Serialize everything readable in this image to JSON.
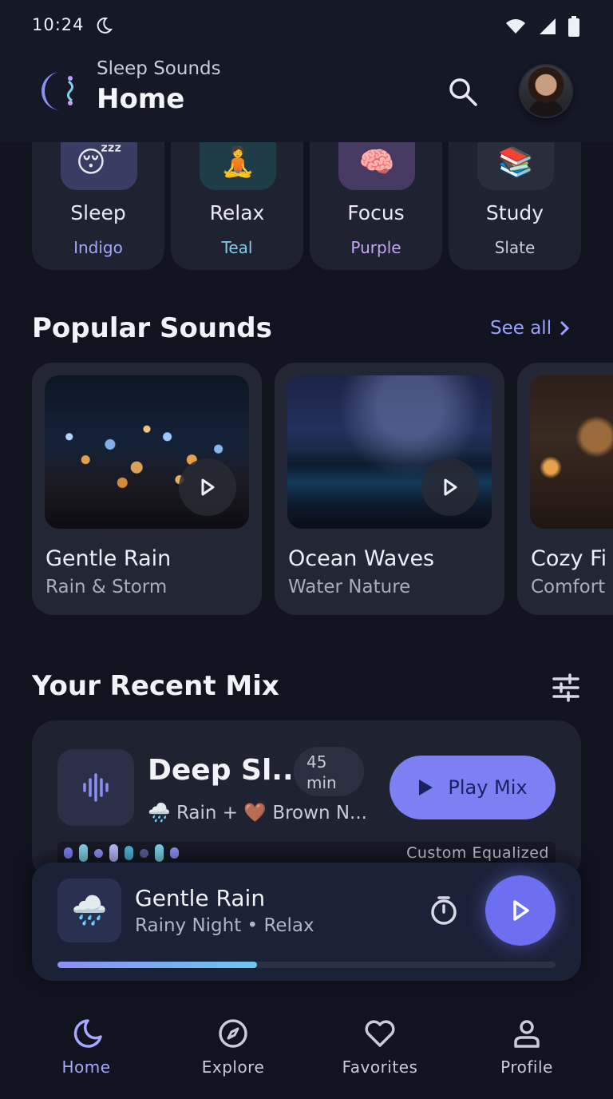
{
  "status_bar": {
    "time": "10:24"
  },
  "header": {
    "app_name": "Sleep Sounds",
    "title": "Home"
  },
  "categories": [
    {
      "name": "Sleep",
      "subtitle": "Indigo",
      "emoji": "😴",
      "tile_color": "#3a3d63",
      "label_color": "#a3a8f5"
    },
    {
      "name": "Relax",
      "subtitle": "Teal",
      "emoji": "🧘",
      "tile_color": "#1f3d48",
      "label_color": "#7fd0e6"
    },
    {
      "name": "Focus",
      "subtitle": "Purple",
      "emoji": "🧠",
      "tile_color": "#463a63",
      "label_color": "#c6a6f2"
    },
    {
      "name": "Study",
      "subtitle": "Slate",
      "emoji": "📚",
      "tile_color": "#2a2e3c",
      "label_color": "#c9cbd8"
    }
  ],
  "popular": {
    "title": "Popular Sounds",
    "see_all": "See all",
    "sounds": [
      {
        "name": "Gentle Rain",
        "category": "Rain & Storm"
      },
      {
        "name": "Ocean Waves",
        "category": "Water Nature"
      },
      {
        "name": "Cozy Fi",
        "category": "Comfort"
      }
    ]
  },
  "recent_mix": {
    "title": "Your Recent Mix",
    "mix_name": "Deep Sl...",
    "duration_value": "45",
    "duration_unit": "min",
    "description": "🌧️ Rain + 🤎 Brown N...",
    "play_label": "Play Mix",
    "eq_label": "Custom Equalized"
  },
  "now_playing": {
    "title": "Gentle Rain",
    "subtitle": "Rainy Night • Relax",
    "icon": "🌧️",
    "progress": 0.4
  },
  "nav": [
    {
      "label": "Home",
      "active": true
    },
    {
      "label": "Explore",
      "active": false
    },
    {
      "label": "Favorites",
      "active": false
    },
    {
      "label": "Profile",
      "active": false
    }
  ],
  "colors": {
    "accent": "#7c80f2",
    "background": "#11131f",
    "card": "#1f2230"
  }
}
